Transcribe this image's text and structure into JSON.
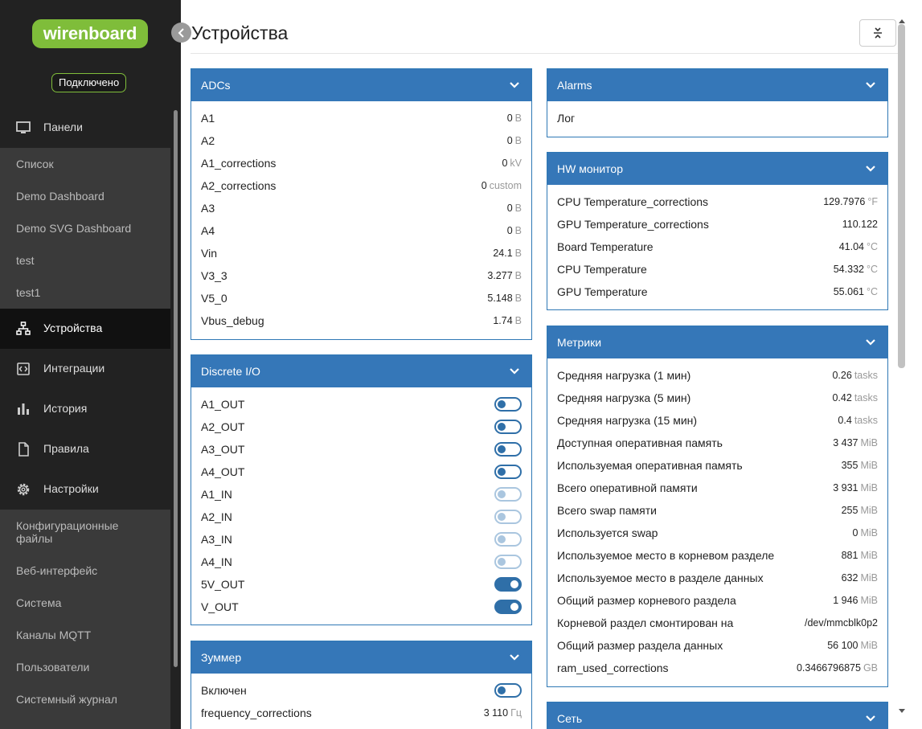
{
  "sidebar": {
    "logo": "wirenboard",
    "status": "Подключено",
    "items": [
      {
        "label": "Панели",
        "icon": "monitor-icon"
      },
      {
        "label": "Устройства",
        "icon": "devices-icon"
      },
      {
        "label": "Интеграции",
        "icon": "integrations-icon"
      },
      {
        "label": "История",
        "icon": "chart-icon"
      },
      {
        "label": "Правила",
        "icon": "document-icon"
      },
      {
        "label": "Настройки",
        "icon": "gear-icon"
      }
    ],
    "dashboards": [
      "Список",
      "Demo Dashboard",
      "Demo SVG Dashboard",
      "test",
      "test1"
    ],
    "settings": [
      "Конфигурационные файлы",
      "Веб-интерфейс",
      "Система",
      "Каналы MQTT",
      "Пользователи",
      "Системный журнал"
    ]
  },
  "header": {
    "title": "Устройства"
  },
  "panels": {
    "adcs": {
      "title": "ADCs",
      "rows": [
        {
          "name": "A1",
          "value": "0",
          "unit": "В"
        },
        {
          "name": "A2",
          "value": "0",
          "unit": "В"
        },
        {
          "name": "A1_corrections",
          "value": "0",
          "unit": "kV"
        },
        {
          "name": "A2_corrections",
          "value": "0",
          "unit": "custom"
        },
        {
          "name": "A3",
          "value": "0",
          "unit": "В"
        },
        {
          "name": "A4",
          "value": "0",
          "unit": "В"
        },
        {
          "name": "Vin",
          "value": "24.1",
          "unit": "В"
        },
        {
          "name": "V3_3",
          "value": "3.277",
          "unit": "В"
        },
        {
          "name": "V5_0",
          "value": "5.148",
          "unit": "В"
        },
        {
          "name": "Vbus_debug",
          "value": "1.74",
          "unit": "В"
        }
      ]
    },
    "discrete": {
      "title": "Discrete I/O",
      "rows": [
        {
          "name": "A1_OUT",
          "state": "off"
        },
        {
          "name": "A2_OUT",
          "state": "off"
        },
        {
          "name": "A3_OUT",
          "state": "off"
        },
        {
          "name": "A4_OUT",
          "state": "off"
        },
        {
          "name": "A1_IN",
          "state": "disabled"
        },
        {
          "name": "A2_IN",
          "state": "disabled"
        },
        {
          "name": "A3_IN",
          "state": "disabled"
        },
        {
          "name": "A4_IN",
          "state": "disabled"
        },
        {
          "name": "5V_OUT",
          "state": "on"
        },
        {
          "name": "V_OUT",
          "state": "on"
        }
      ]
    },
    "buzzer": {
      "title": "Зуммер",
      "rows": [
        {
          "name": "Включен",
          "state": "off"
        },
        {
          "name": "frequency_corrections",
          "value": "3 110",
          "unit": "Гц"
        }
      ]
    },
    "alarms": {
      "title": "Alarms",
      "rows": [
        {
          "name": "Лог"
        }
      ]
    },
    "hw": {
      "title": "HW монитор",
      "rows": [
        {
          "name": "CPU Temperature_corrections",
          "value": "129.7976",
          "unit": "°F"
        },
        {
          "name": "GPU Temperature_corrections",
          "value": "110.122",
          "unit": ""
        },
        {
          "name": "Board Temperature",
          "value": "41.04",
          "unit": "°C"
        },
        {
          "name": "CPU Temperature",
          "value": "54.332",
          "unit": "°C"
        },
        {
          "name": "GPU Temperature",
          "value": "55.061",
          "unit": "°C"
        }
      ]
    },
    "metrics": {
      "title": "Метрики",
      "rows": [
        {
          "name": "Средняя нагрузка (1 мин)",
          "value": "0.26",
          "unit": "tasks"
        },
        {
          "name": "Средняя нагрузка (5 мин)",
          "value": "0.42",
          "unit": "tasks"
        },
        {
          "name": "Средняя нагрузка (15 мин)",
          "value": "0.4",
          "unit": "tasks"
        },
        {
          "name": "Доступная оперативная память",
          "value": "3 437",
          "unit": "MiB"
        },
        {
          "name": "Используемая оперативная память",
          "value": "355",
          "unit": "MiB"
        },
        {
          "name": "Всего оперативной памяти",
          "value": "3 931",
          "unit": "MiB"
        },
        {
          "name": "Всего swap памяти",
          "value": "255",
          "unit": "MiB"
        },
        {
          "name": "Используется swap",
          "value": "0",
          "unit": "MiB"
        },
        {
          "name": "Используемое место в корневом разделе",
          "value": "881",
          "unit": "MiB"
        },
        {
          "name": "Используемое место в разделе данных",
          "value": "632",
          "unit": "MiB"
        },
        {
          "name": "Общий размер корневого раздела",
          "value": "1 946",
          "unit": "MiB"
        },
        {
          "name": "Корневой раздел смонтирован на",
          "value": "/dev/mmcblk0p2",
          "unit": ""
        },
        {
          "name": "Общий размер раздела данных",
          "value": "56 100",
          "unit": "MiB"
        },
        {
          "name": "ram_used_corrections",
          "value": "0.3466796875",
          "unit": "GB"
        }
      ]
    },
    "network": {
      "title": "Сеть"
    }
  },
  "colors": {
    "sidebar": "#222222",
    "accent": "#3577b8",
    "brand": "#7fbd3a"
  }
}
